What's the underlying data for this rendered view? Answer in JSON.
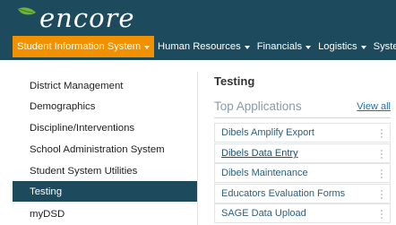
{
  "brand": {
    "name": "encore",
    "icon": "leaf-icon"
  },
  "nav": {
    "items": [
      {
        "label": "Student Information System",
        "active": true
      },
      {
        "label": "Human Resources",
        "active": false
      },
      {
        "label": "Financials",
        "active": false
      },
      {
        "label": "Logistics",
        "active": false
      },
      {
        "label": "System Administ",
        "active": false
      }
    ]
  },
  "sidebar": {
    "items": [
      {
        "label": "District Management"
      },
      {
        "label": "Demographics"
      },
      {
        "label": "Discipline/Interventions"
      },
      {
        "label": "School Administration System"
      },
      {
        "label": "Student System Utilities"
      },
      {
        "label": "Testing",
        "active": true
      },
      {
        "label": "myDSD"
      }
    ]
  },
  "main": {
    "title": "Testing",
    "top_apps": {
      "title": "Top Applications",
      "view_all": "View all",
      "items": [
        {
          "label": "Dibels Amplify Export"
        },
        {
          "label": "Dibels Data Entry"
        },
        {
          "label": "Dibels Maintenance"
        },
        {
          "label": "Educators Evaluation Forms"
        },
        {
          "label": "SAGE Data Upload"
        }
      ]
    }
  },
  "colors": {
    "header": "#1d4a5c",
    "active_nav": "#f29100",
    "active_side": "#1d4a5c",
    "leaf": "#6fb53a"
  }
}
